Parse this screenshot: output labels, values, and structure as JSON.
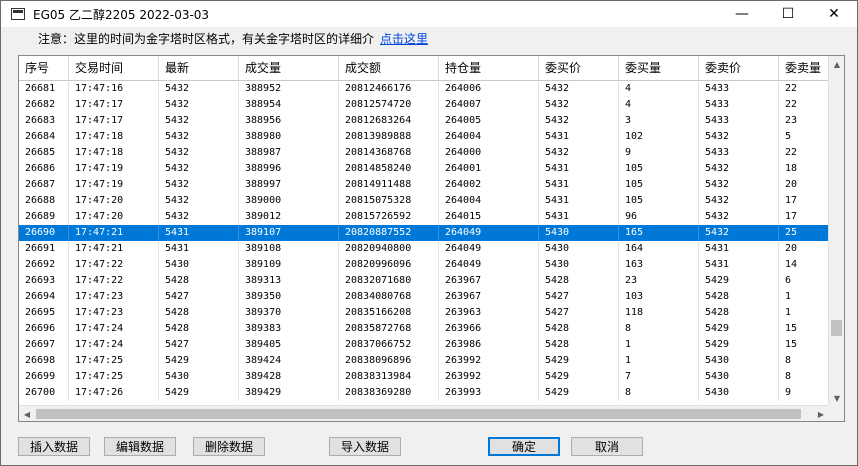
{
  "window": {
    "title": "EG05 乙二醇2205 2022-03-03",
    "minimize_icon": "minimize-icon",
    "maximize_icon": "maximize-icon",
    "close_icon": "close-icon"
  },
  "notice": {
    "text": "注意：这里的时间为金字塔时区格式，有关金字塔时区的详细介",
    "link": "点击这里"
  },
  "table": {
    "columns": [
      "序号",
      "交易时间",
      "最新",
      "成交量",
      "成交额",
      "持仓量",
      "委买价",
      "委买量",
      "委卖价",
      "委卖量"
    ],
    "selected_row_index": 9,
    "rows": [
      [
        "26681",
        "17:47:16",
        "5432",
        "388952",
        "20812466176",
        "264006",
        "5432",
        "4",
        "5433",
        "22"
      ],
      [
        "26682",
        "17:47:17",
        "5432",
        "388954",
        "20812574720",
        "264007",
        "5432",
        "4",
        "5433",
        "22"
      ],
      [
        "26683",
        "17:47:17",
        "5432",
        "388956",
        "20812683264",
        "264005",
        "5432",
        "3",
        "5433",
        "23"
      ],
      [
        "26684",
        "17:47:18",
        "5432",
        "388980",
        "20813989888",
        "264004",
        "5431",
        "102",
        "5432",
        "5"
      ],
      [
        "26685",
        "17:47:18",
        "5432",
        "388987",
        "20814368768",
        "264000",
        "5432",
        "9",
        "5433",
        "22"
      ],
      [
        "26686",
        "17:47:19",
        "5432",
        "388996",
        "20814858240",
        "264001",
        "5431",
        "105",
        "5432",
        "18"
      ],
      [
        "26687",
        "17:47:19",
        "5432",
        "388997",
        "20814911488",
        "264002",
        "5431",
        "105",
        "5432",
        "20"
      ],
      [
        "26688",
        "17:47:20",
        "5432",
        "389000",
        "20815075328",
        "264004",
        "5431",
        "105",
        "5432",
        "17"
      ],
      [
        "26689",
        "17:47:20",
        "5432",
        "389012",
        "20815726592",
        "264015",
        "5431",
        "96",
        "5432",
        "17"
      ],
      [
        "26690",
        "17:47:21",
        "5431",
        "389107",
        "20820887552",
        "264049",
        "5430",
        "165",
        "5432",
        "25"
      ],
      [
        "26691",
        "17:47:21",
        "5431",
        "389108",
        "20820940800",
        "264049",
        "5430",
        "164",
        "5431",
        "20"
      ],
      [
        "26692",
        "17:47:22",
        "5430",
        "389109",
        "20820996096",
        "264049",
        "5430",
        "163",
        "5431",
        "14"
      ],
      [
        "26693",
        "17:47:22",
        "5428",
        "389313",
        "20832071680",
        "263967",
        "5428",
        "23",
        "5429",
        "6"
      ],
      [
        "26694",
        "17:47:23",
        "5427",
        "389350",
        "20834080768",
        "263967",
        "5427",
        "103",
        "5428",
        "1"
      ],
      [
        "26695",
        "17:47:23",
        "5428",
        "389370",
        "20835166208",
        "263963",
        "5427",
        "118",
        "5428",
        "1"
      ],
      [
        "26696",
        "17:47:24",
        "5428",
        "389383",
        "20835872768",
        "263966",
        "5428",
        "8",
        "5429",
        "15"
      ],
      [
        "26697",
        "17:47:24",
        "5427",
        "389405",
        "20837066752",
        "263986",
        "5428",
        "1",
        "5429",
        "15"
      ],
      [
        "26698",
        "17:47:25",
        "5429",
        "389424",
        "20838096896",
        "263992",
        "5429",
        "1",
        "5430",
        "8"
      ],
      [
        "26699",
        "17:47:25",
        "5430",
        "389428",
        "20838313984",
        "263992",
        "5429",
        "7",
        "5430",
        "8"
      ],
      [
        "26700",
        "17:47:26",
        "5429",
        "389429",
        "20838369280",
        "263993",
        "5429",
        "8",
        "5430",
        "9"
      ]
    ]
  },
  "buttons": {
    "insert": "插入数据",
    "edit": "编辑数据",
    "delete": "删除数据",
    "import": "导入数据",
    "ok": "确定",
    "cancel": "取消"
  }
}
